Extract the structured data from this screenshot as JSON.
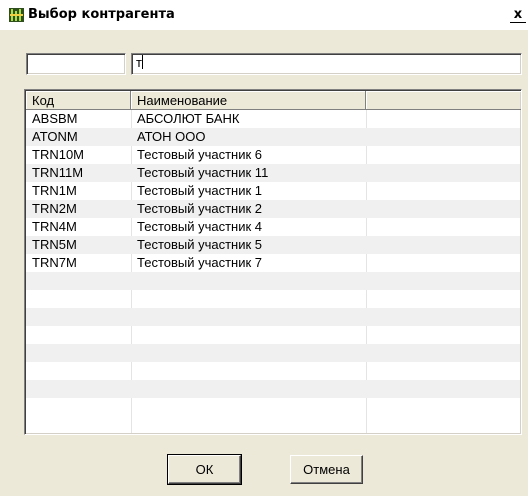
{
  "window": {
    "title": "Выбор контрагента",
    "close_glyph": "x",
    "icon": "app-icon"
  },
  "filter": {
    "code_value": "",
    "name_value": "т"
  },
  "list": {
    "columns": [
      "Код",
      "Наименование",
      ""
    ],
    "rows": [
      {
        "code": "ABSBM",
        "name": "АБСОЛЮТ БАНК"
      },
      {
        "code": "ATONM",
        "name": "АТОН ООО"
      },
      {
        "code": "TRN10M",
        "name": "Тестовый участник 6"
      },
      {
        "code": "TRN11M",
        "name": "Тестовый участник 11"
      },
      {
        "code": "TRN1M",
        "name": "Тестовый участник 1"
      },
      {
        "code": "TRN2M",
        "name": "Тестовый участник 2"
      },
      {
        "code": "TRN4M",
        "name": "Тестовый участник 4"
      },
      {
        "code": "TRN5M",
        "name": "Тестовый участник 5"
      },
      {
        "code": "TRN7M",
        "name": "Тестовый участник 7"
      }
    ]
  },
  "buttons": {
    "ok": "ОК",
    "cancel": "Отмена"
  }
}
